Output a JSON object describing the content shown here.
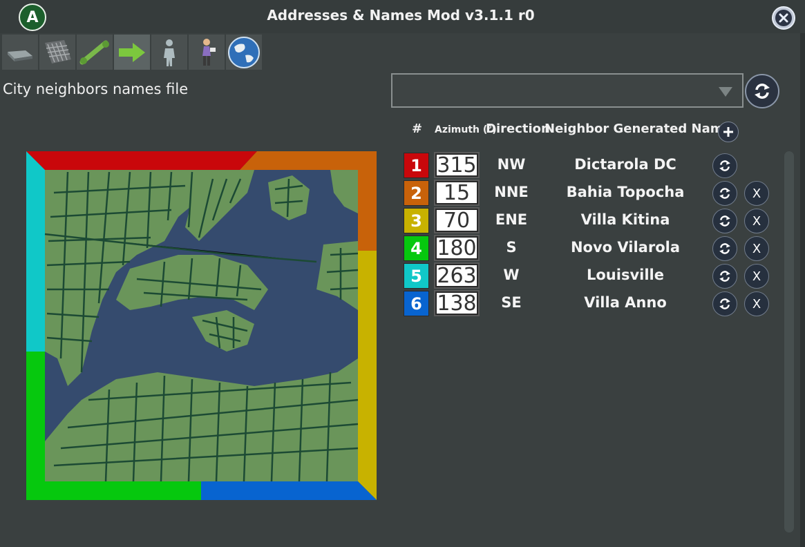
{
  "window": {
    "logo_letter": "A",
    "title": "Addresses & Names Mod v3.1.1 r0",
    "close_icon": "close-x-icon"
  },
  "toolbar": {
    "tabs": [
      {
        "icon": "road-tab-icon",
        "active": false
      },
      {
        "icon": "buildings-tab-icon",
        "active": false
      },
      {
        "icon": "connection-tab-icon",
        "active": false
      },
      {
        "icon": "neighbors-arrow-tab-icon",
        "active": true
      },
      {
        "icon": "citizen-tab-icon",
        "active": false
      },
      {
        "icon": "person-tab-icon",
        "active": false
      },
      {
        "icon": "globe-tab-icon",
        "active": false
      }
    ]
  },
  "file_selector": {
    "label": "City neighbors names file",
    "selected": "",
    "reload_icon": "reload-icon"
  },
  "table": {
    "headers": {
      "index": "#",
      "azimuth": "Azimuth (°)",
      "direction": "Direction",
      "name": "Neighbor Generated Name"
    },
    "add_icon": "plus-icon",
    "rows": [
      {
        "index": "1",
        "color": "#c9070b",
        "azimuth": "315",
        "direction": "NW",
        "name": "Dictarola DC",
        "deletable": false
      },
      {
        "index": "2",
        "color": "#c8620a",
        "azimuth": "15",
        "direction": "NNE",
        "name": "Bahia Topocha",
        "deletable": true
      },
      {
        "index": "3",
        "color": "#c8b200",
        "azimuth": "70",
        "direction": "ENE",
        "name": "Villa Kitina",
        "deletable": true
      },
      {
        "index": "4",
        "color": "#06c80e",
        "azimuth": "180",
        "direction": "S",
        "name": "Novo Vilarola",
        "deletable": true
      },
      {
        "index": "5",
        "color": "#10c8c8",
        "azimuth": "263",
        "direction": "W",
        "name": "Louisville",
        "deletable": true
      },
      {
        "index": "6",
        "color": "#0864d0",
        "azimuth": "138",
        "direction": "SE",
        "name": "Villa Anno",
        "deletable": true
      }
    ],
    "delete_label": "X"
  },
  "map": {
    "water_color": "#354b6e",
    "land_color": "#6a955a",
    "road_color": "#1c4a34"
  }
}
